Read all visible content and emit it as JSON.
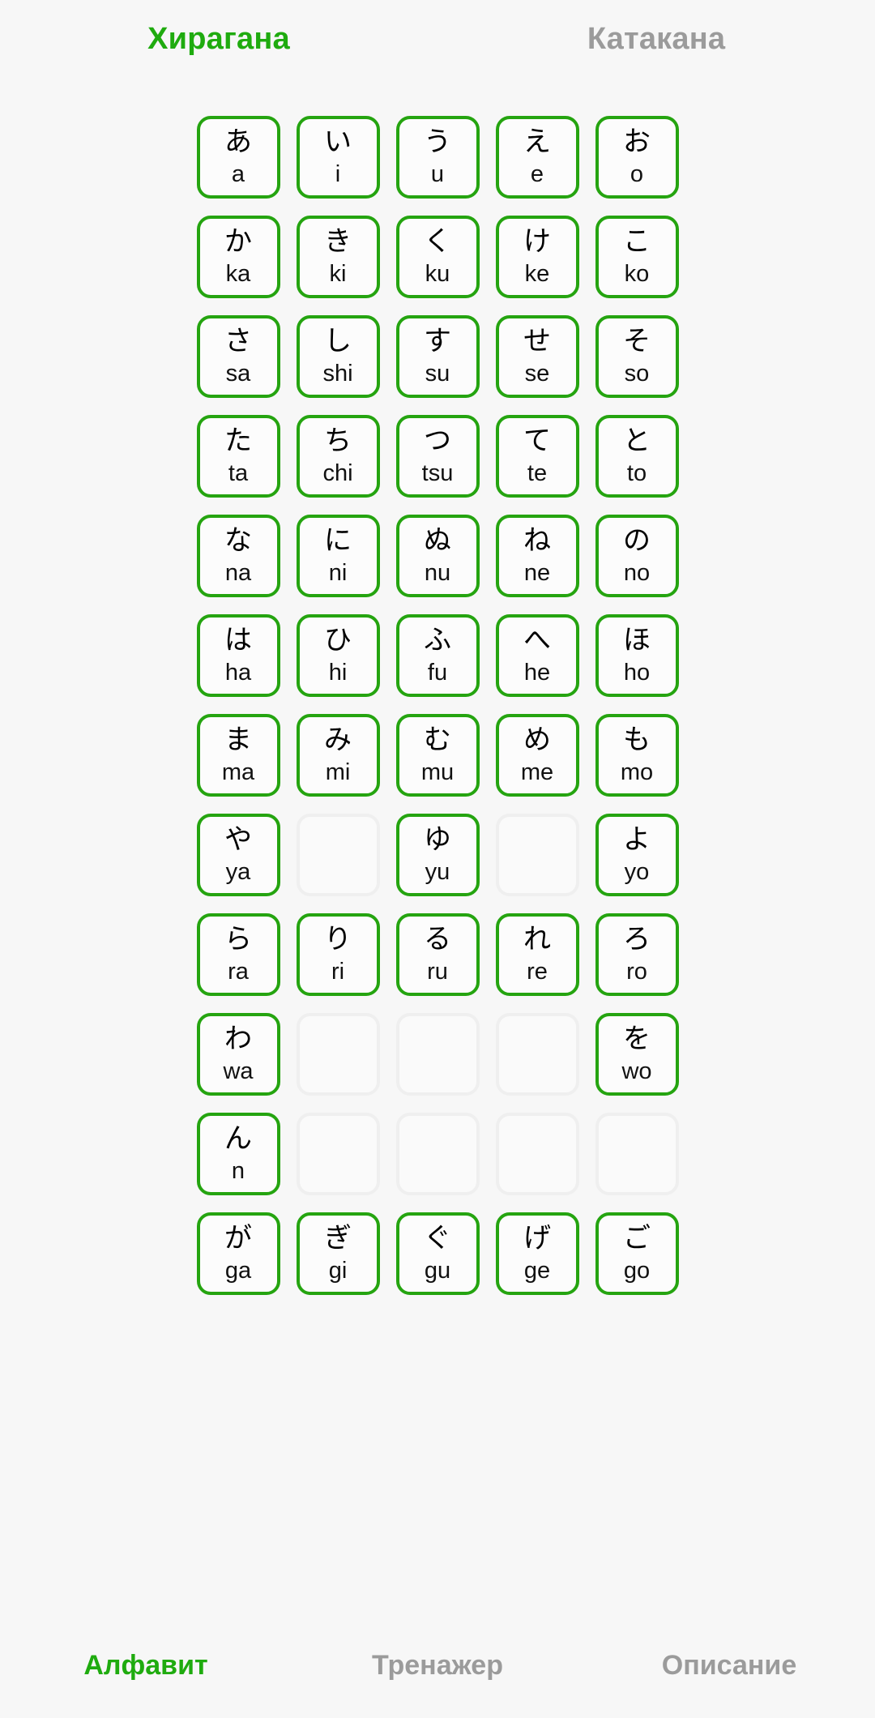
{
  "app": {
    "background_color": "#f7f7f7",
    "accent_color": "#1fab0f",
    "card_border_color": "#25a410",
    "empty_card_border_color": "#efefef",
    "inactive_text_color": "#9b9b9b"
  },
  "script_tabs": [
    {
      "label": "Хирагана",
      "active": true
    },
    {
      "label": "Катакана",
      "active": false
    }
  ],
  "grid": {
    "columns": 5,
    "rows": [
      [
        {
          "char": "あ",
          "romaji": "a"
        },
        {
          "char": "い",
          "romaji": "i"
        },
        {
          "char": "う",
          "romaji": "u"
        },
        {
          "char": "え",
          "romaji": "e"
        },
        {
          "char": "お",
          "romaji": "o"
        }
      ],
      [
        {
          "char": "か",
          "romaji": "ka"
        },
        {
          "char": "き",
          "romaji": "ki"
        },
        {
          "char": "く",
          "romaji": "ku"
        },
        {
          "char": "け",
          "romaji": "ke"
        },
        {
          "char": "こ",
          "romaji": "ko"
        }
      ],
      [
        {
          "char": "さ",
          "romaji": "sa"
        },
        {
          "char": "し",
          "romaji": "shi"
        },
        {
          "char": "す",
          "romaji": "su"
        },
        {
          "char": "せ",
          "romaji": "se"
        },
        {
          "char": "そ",
          "romaji": "so"
        }
      ],
      [
        {
          "char": "た",
          "romaji": "ta"
        },
        {
          "char": "ち",
          "romaji": "chi"
        },
        {
          "char": "つ",
          "romaji": "tsu"
        },
        {
          "char": "て",
          "romaji": "te"
        },
        {
          "char": "と",
          "romaji": "to"
        }
      ],
      [
        {
          "char": "な",
          "romaji": "na"
        },
        {
          "char": "に",
          "romaji": "ni"
        },
        {
          "char": "ぬ",
          "romaji": "nu"
        },
        {
          "char": "ね",
          "romaji": "ne"
        },
        {
          "char": "の",
          "romaji": "no"
        }
      ],
      [
        {
          "char": "は",
          "romaji": "ha"
        },
        {
          "char": "ひ",
          "romaji": "hi"
        },
        {
          "char": "ふ",
          "romaji": "fu"
        },
        {
          "char": "へ",
          "romaji": "he"
        },
        {
          "char": "ほ",
          "romaji": "ho"
        }
      ],
      [
        {
          "char": "ま",
          "romaji": "ma"
        },
        {
          "char": "み",
          "romaji": "mi"
        },
        {
          "char": "む",
          "romaji": "mu"
        },
        {
          "char": "め",
          "romaji": "me"
        },
        {
          "char": "も",
          "romaji": "mo"
        }
      ],
      [
        {
          "char": "や",
          "romaji": "ya"
        },
        {
          "char": "",
          "romaji": ""
        },
        {
          "char": "ゆ",
          "romaji": "yu"
        },
        {
          "char": "",
          "romaji": ""
        },
        {
          "char": "よ",
          "romaji": "yo"
        }
      ],
      [
        {
          "char": "ら",
          "romaji": "ra"
        },
        {
          "char": "り",
          "romaji": "ri"
        },
        {
          "char": "る",
          "romaji": "ru"
        },
        {
          "char": "れ",
          "romaji": "re"
        },
        {
          "char": "ろ",
          "romaji": "ro"
        }
      ],
      [
        {
          "char": "わ",
          "romaji": "wa"
        },
        {
          "char": "",
          "romaji": ""
        },
        {
          "char": "",
          "romaji": ""
        },
        {
          "char": "",
          "romaji": ""
        },
        {
          "char": "を",
          "romaji": "wo"
        }
      ],
      [
        {
          "char": "ん",
          "romaji": "n"
        },
        {
          "char": "",
          "romaji": ""
        },
        {
          "char": "",
          "romaji": ""
        },
        {
          "char": "",
          "romaji": ""
        },
        {
          "char": "",
          "romaji": ""
        }
      ],
      [
        {
          "char": "が",
          "romaji": "ga"
        },
        {
          "char": "ぎ",
          "romaji": "gi"
        },
        {
          "char": "ぐ",
          "romaji": "gu"
        },
        {
          "char": "げ",
          "romaji": "ge"
        },
        {
          "char": "ご",
          "romaji": "go"
        }
      ]
    ]
  },
  "bottom_nav": [
    {
      "label": "Алфавит",
      "active": true
    },
    {
      "label": "Тренажер",
      "active": false
    },
    {
      "label": "Описание",
      "active": false
    }
  ]
}
